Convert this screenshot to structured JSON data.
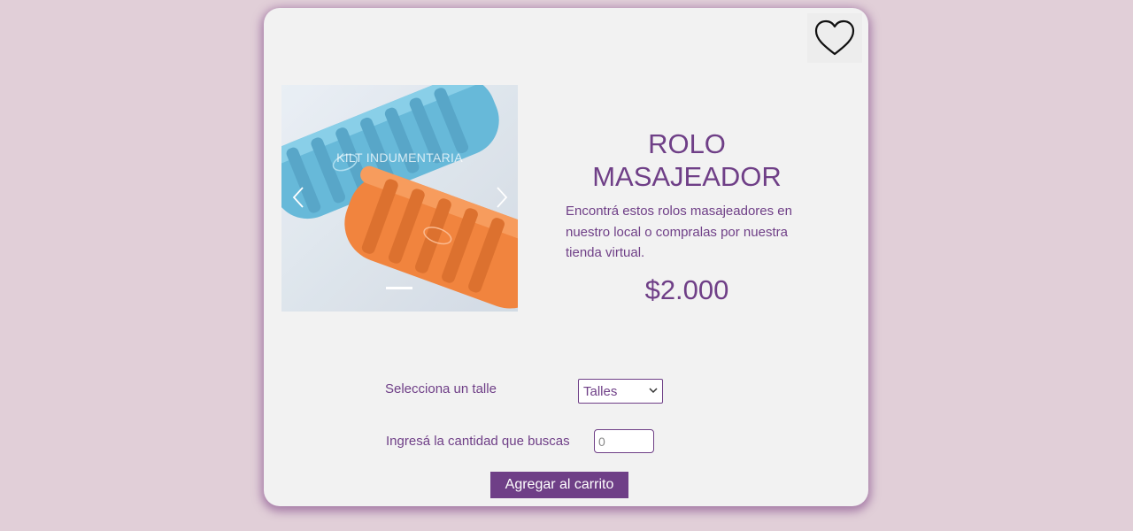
{
  "colors": {
    "background": "#e1cfd8",
    "card": "#f2f2f2",
    "accent": "#6f3f87"
  },
  "product": {
    "title": "ROLO MASAJEADOR",
    "description": "Encontrá estos rolos masajeadores en nuestro local o compralas por nuestra tienda virtual.",
    "price": "$2.000",
    "favorite_icon": "heart-outline-icon"
  },
  "carousel": {
    "watermark": "KILT INDUMENTARIA",
    "prev_icon": "chevron-left-icon",
    "next_icon": "chevron-right-icon",
    "slide_count": 1,
    "active_slide": 1
  },
  "form": {
    "size_label": "Selecciona un talle",
    "size_selected": "Talles",
    "quantity_label": "Ingresá la cantidad que buscas",
    "quantity_value": "0",
    "add_to_cart_label": "Agregar al carrito"
  }
}
